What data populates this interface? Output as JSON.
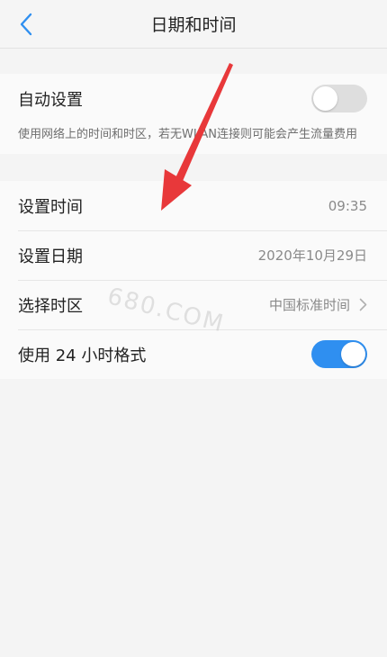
{
  "header": {
    "title": "日期和时间",
    "back_icon": "chevron-left-icon"
  },
  "auto": {
    "label": "自动设置",
    "toggle_on": false,
    "description": "使用网络上的时间和时区，若无WLAN连接则可能会产生流量费用"
  },
  "rows": [
    {
      "label": "设置时间",
      "value": "09:35"
    },
    {
      "label": "设置日期",
      "value": "2020年10月29日"
    },
    {
      "label": "选择时区",
      "value": "中国标准时间"
    }
  ],
  "hour24": {
    "label": "使用 24 小时格式",
    "toggle_on": true
  },
  "watermark": "680.COM",
  "colors": {
    "accent": "#2f8ff0",
    "arrow": "#e8383a"
  }
}
